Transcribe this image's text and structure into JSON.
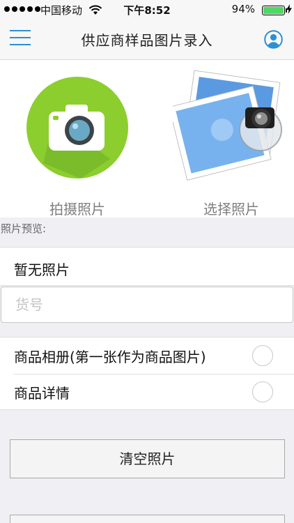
{
  "status_bar": {
    "carrier": "中国移动",
    "time": "下午8:52",
    "battery_percent": "94%",
    "battery_level": 0.94,
    "signal_dots": 5
  },
  "nav": {
    "title": "供应商样品图片录入",
    "accent_color": "#2d8fd5"
  },
  "actions": {
    "take_photo_label": "拍摄照片",
    "select_photo_label": "选择照片",
    "camera_bg_color": "#8cce2e"
  },
  "preview": {
    "header": "照片预览:",
    "empty_text": "暂无照片"
  },
  "item_number": {
    "placeholder": "货号",
    "value": ""
  },
  "options": [
    {
      "label": "商品相册(第一张作为商品图片)",
      "selected": false
    },
    {
      "label": "商品详情",
      "selected": false
    }
  ],
  "buttons": {
    "clear_label": "清空照片"
  }
}
